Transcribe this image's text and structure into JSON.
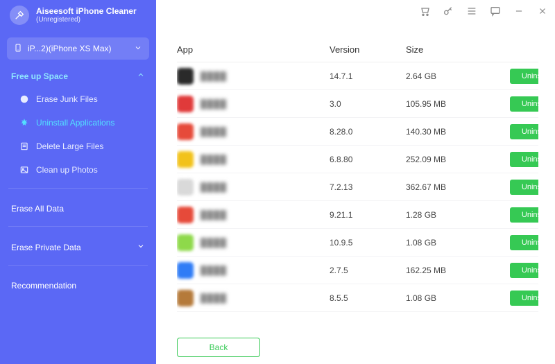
{
  "brand": {
    "title": "Aiseesoft iPhone",
    "subtitle": "Cleaner",
    "status": "(Unregistered)"
  },
  "titlebar": {
    "icons": [
      "cart",
      "key",
      "menu",
      "chat",
      "minimize",
      "close"
    ]
  },
  "device": {
    "label": "iP...2)(iPhone XS Max)"
  },
  "sidebar": {
    "group_free": "Free up Space",
    "items": [
      {
        "label": "Erase Junk Files",
        "icon": "clock-icon"
      },
      {
        "label": "Uninstall Applications",
        "icon": "burst-icon",
        "active": true
      },
      {
        "label": "Delete Large Files",
        "icon": "file-icon"
      },
      {
        "label": "Clean up Photos",
        "icon": "photo-icon"
      }
    ],
    "erase_all": "Erase All Data",
    "erase_private": "Erase Private Data",
    "recommendation": "Recommendation"
  },
  "table": {
    "headers": {
      "app": "App",
      "version": "Version",
      "size": "Size"
    },
    "uninstall_label": "Uninstall",
    "rows": [
      {
        "iconColor": "#2a2a2a",
        "version": "14.7.1",
        "size": "2.64 GB"
      },
      {
        "iconColor": "#e03a3a",
        "version": "3.0",
        "size": "105.95 MB"
      },
      {
        "iconColor": "#e64a3a",
        "version": "8.28.0",
        "size": "140.30 MB"
      },
      {
        "iconColor": "#f2c21a",
        "version": "6.8.80",
        "size": "252.09 MB"
      },
      {
        "iconColor": "#d9d9d9",
        "version": "7.2.13",
        "size": "362.67 MB"
      },
      {
        "iconColor": "#e64a3a",
        "version": "9.21.1",
        "size": "1.28 GB"
      },
      {
        "iconColor": "#8ed94a",
        "version": "10.9.5",
        "size": "1.08 GB"
      },
      {
        "iconColor": "#2f7cf6",
        "version": "2.7.5",
        "size": "162.25 MB"
      },
      {
        "iconColor": "#b57a3a",
        "version": "8.5.5",
        "size": "1.08 GB"
      }
    ]
  },
  "footer": {
    "back": "Back"
  },
  "colors": {
    "sidebar": "#5b68f5",
    "accent": "#36c954",
    "active_text": "#53e0ff"
  }
}
